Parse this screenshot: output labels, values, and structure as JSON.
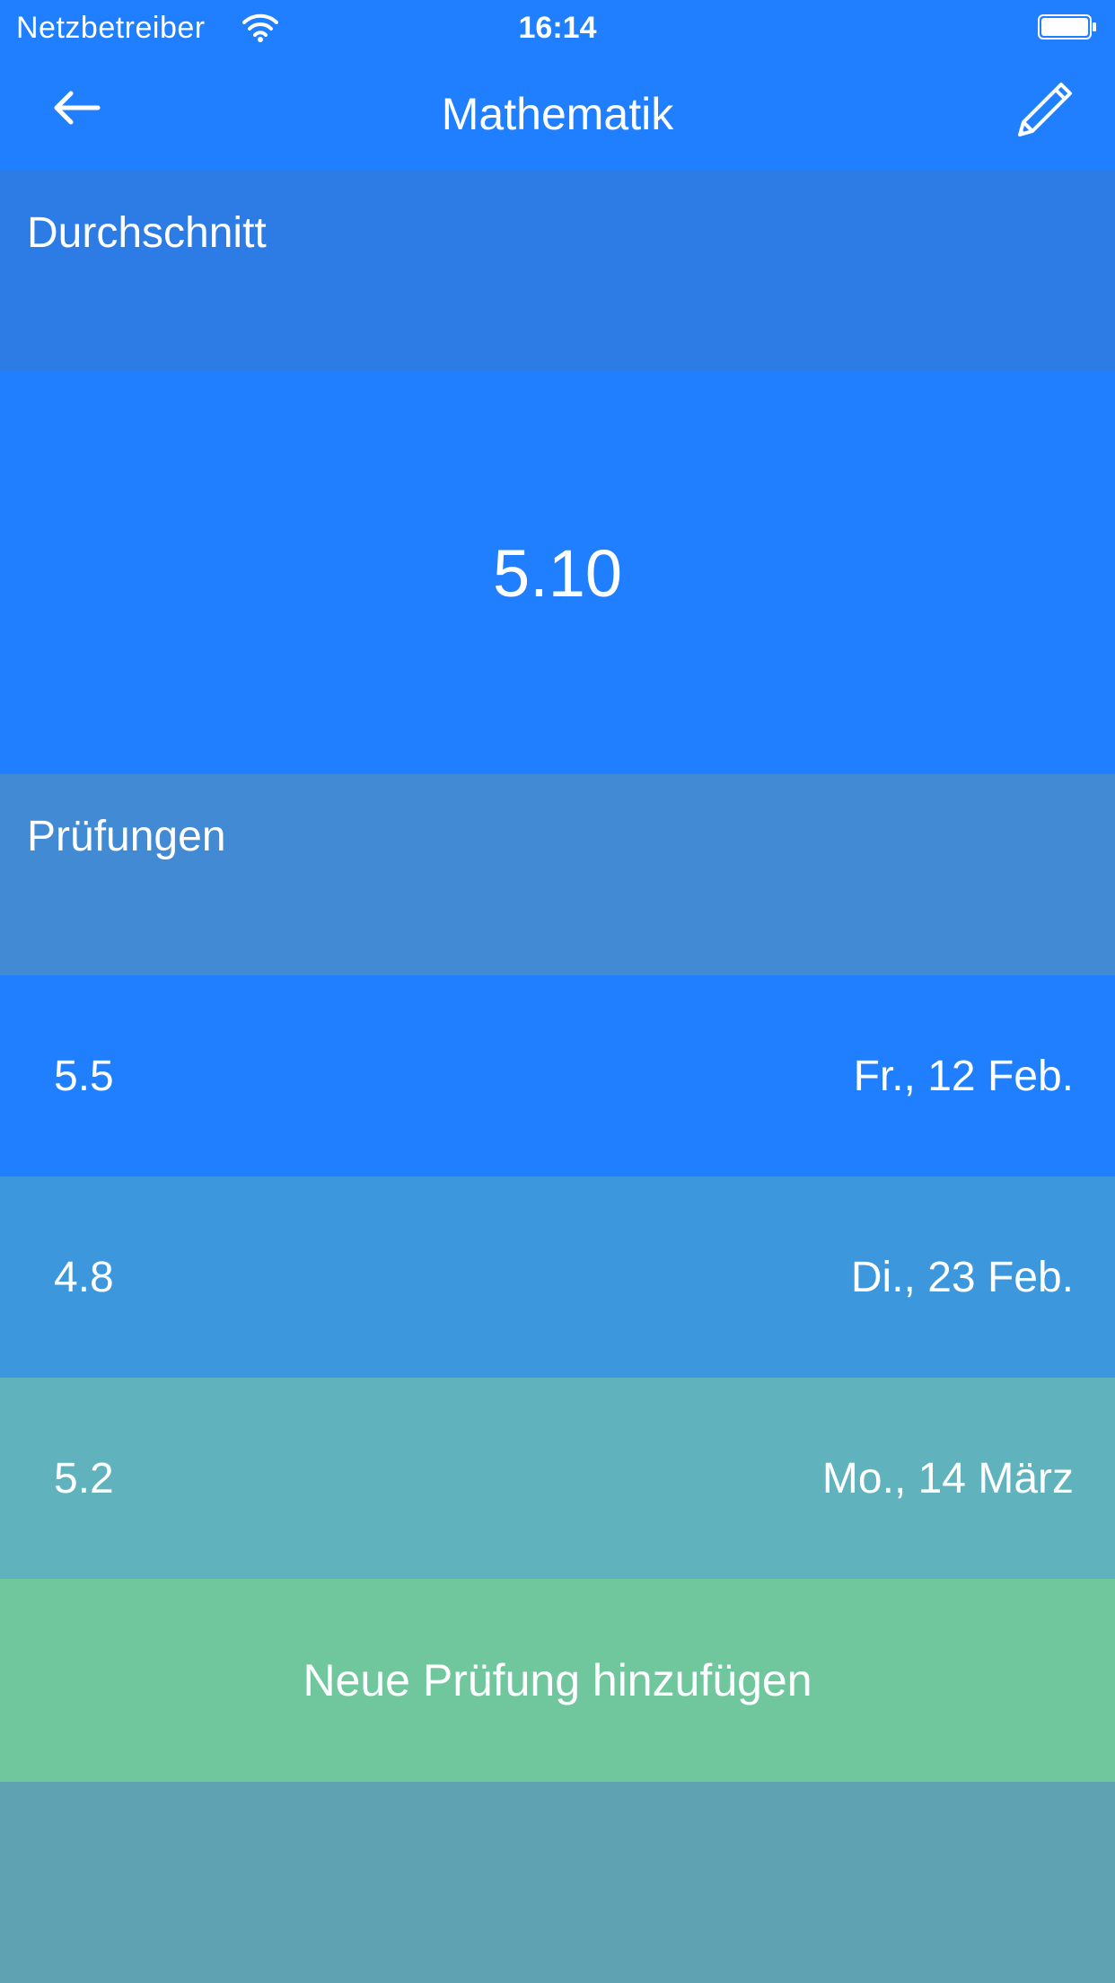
{
  "status_bar": {
    "carrier": "Netzbetreiber",
    "time": "16:14",
    "wifi_icon": "wifi-icon",
    "battery_icon": "battery-icon"
  },
  "nav": {
    "title": "Mathematik",
    "back_icon": "arrow-left-icon",
    "edit_icon": "pencil-icon"
  },
  "average": {
    "header": "Durchschnitt",
    "value": "5.10"
  },
  "exams": {
    "header": "Prüfungen",
    "rows": [
      {
        "grade": "5.5",
        "date": "Fr., 12 Feb."
      },
      {
        "grade": "4.8",
        "date": "Di., 23 Feb."
      },
      {
        "grade": "5.2",
        "date": "Mo., 14 März"
      }
    ],
    "add_label": "Neue Prüfung hinzufügen"
  },
  "colors": {
    "primary": "#1f7fff",
    "header_avg": "#2d7ce6",
    "header_exams": "#428ad3",
    "row2": "#3d97dd",
    "row3": "#60b3bd",
    "add_button": "#71c79d",
    "footer": "#5fa3b2"
  }
}
